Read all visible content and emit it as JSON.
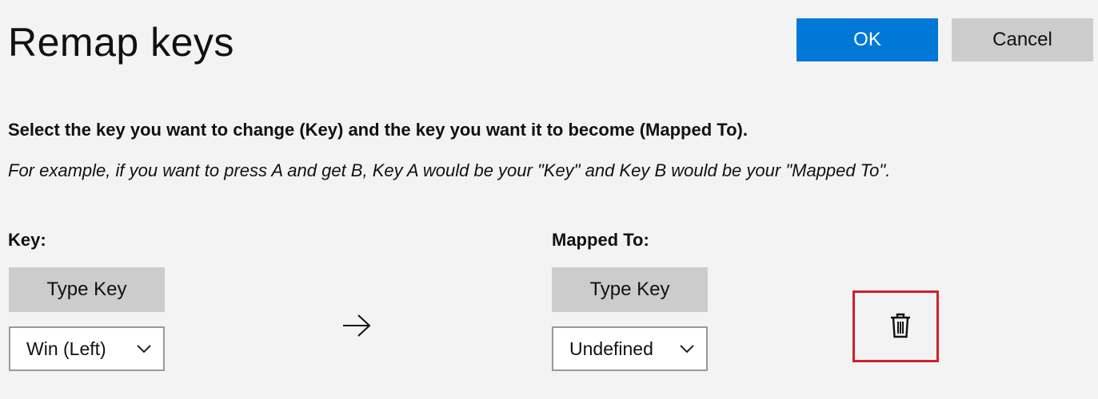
{
  "header": {
    "title": "Remap keys",
    "ok_label": "OK",
    "cancel_label": "Cancel"
  },
  "instructions": {
    "main": "Select the key you want to change (Key) and the key you want it to become (Mapped To).",
    "example": "For example, if you want to press A and get B, Key A would be your \"Key\" and Key B would be your \"Mapped To\"."
  },
  "key_column": {
    "header": "Key:",
    "type_key_label": "Type Key",
    "selected_value": "Win (Left)"
  },
  "mapped_column": {
    "header": "Mapped To:",
    "type_key_label": "Type Key",
    "selected_value": "Undefined"
  },
  "icons": {
    "arrow": "arrow-right-icon",
    "delete": "trash-icon",
    "dropdown": "chevron-down-icon"
  },
  "colors": {
    "accent": "#0078d7",
    "highlight": "#d0202a"
  }
}
